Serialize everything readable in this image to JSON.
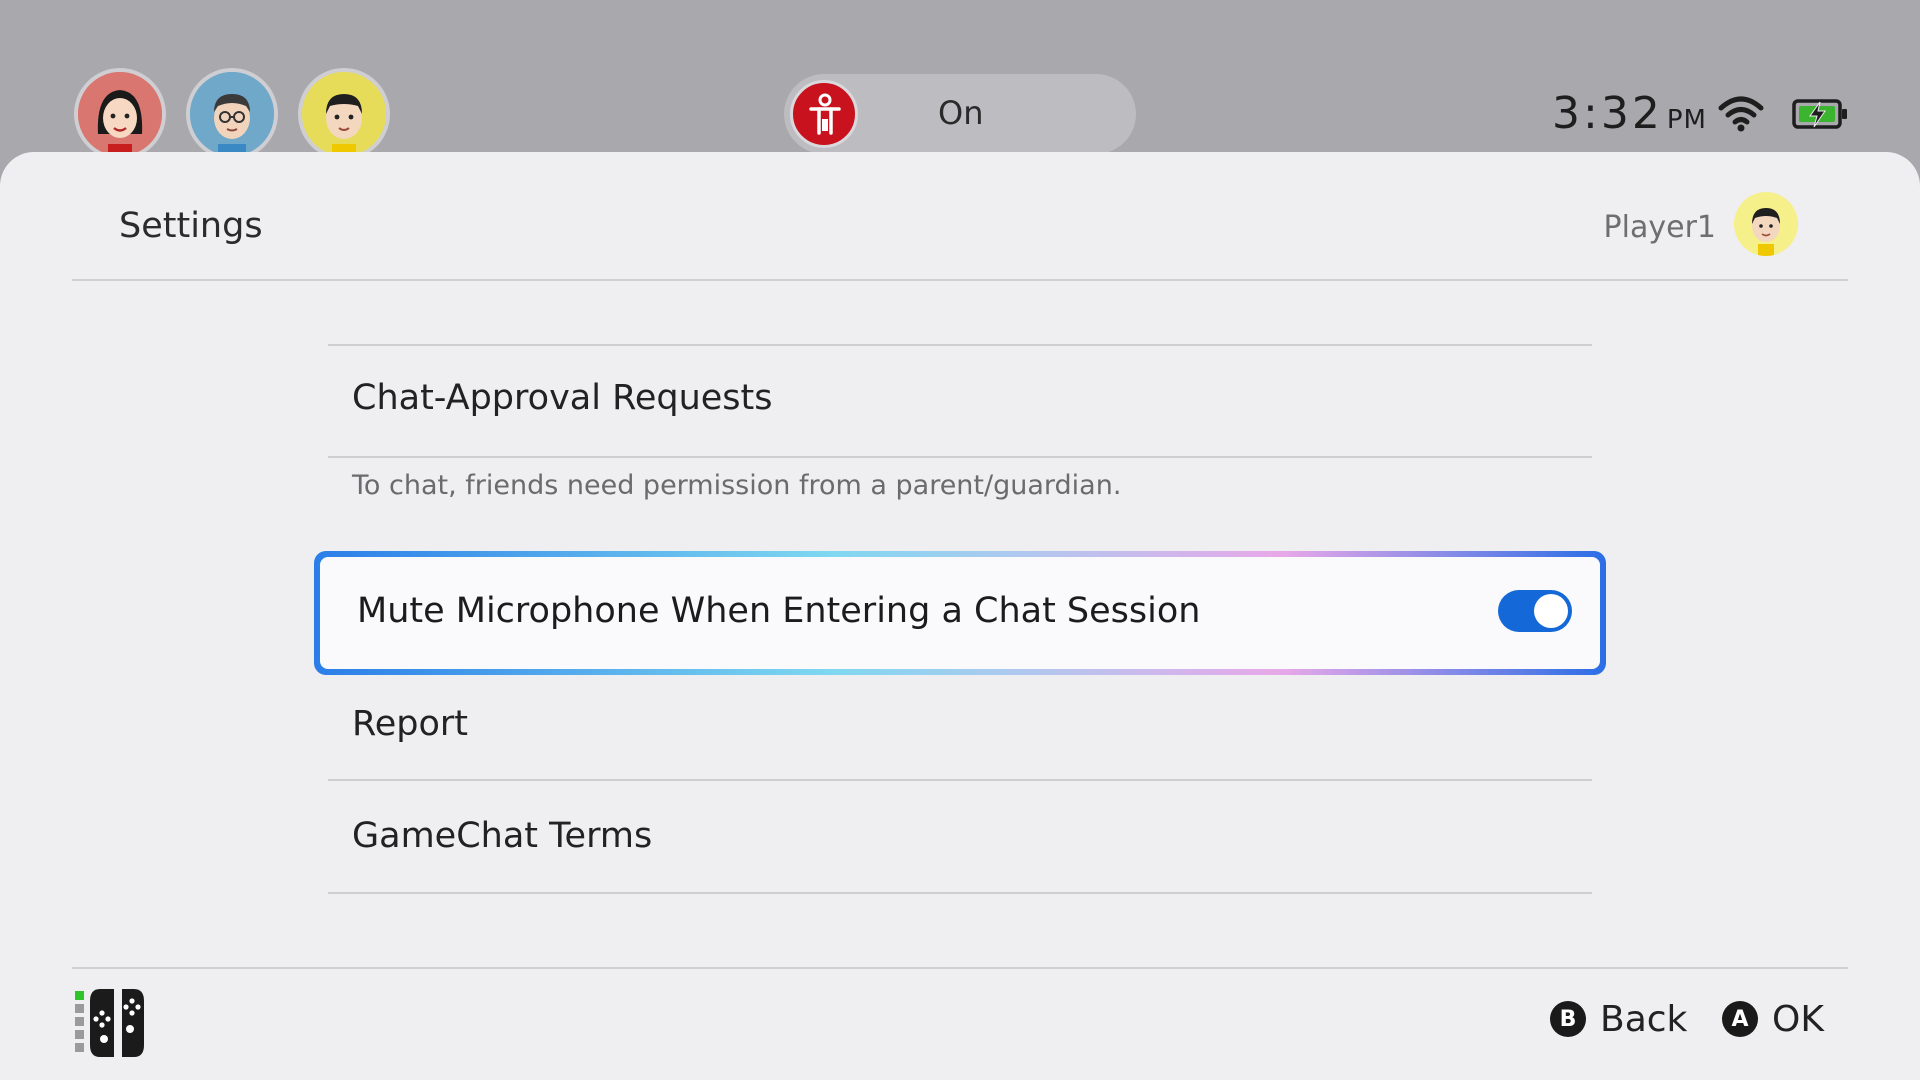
{
  "topbar": {
    "users": [
      {
        "name": "user-avatar-1",
        "color": "#d9766f"
      },
      {
        "name": "user-avatar-2",
        "color": "#6fa8c9"
      },
      {
        "name": "user-avatar-3",
        "color": "#e6dc5a"
      }
    ],
    "parental_control_icon": "parental-controls-icon",
    "parental_control_status": "On",
    "clock_time": "3:32",
    "clock_ampm": "PM",
    "wifi_icon": "wifi-icon",
    "battery_icon": "battery-charging-icon"
  },
  "panel": {
    "title": "Settings",
    "player_name": "Player1"
  },
  "list": {
    "items": [
      {
        "label": "Chat-Approval Requests"
      },
      {
        "label": "Mute Microphone When Entering a Chat Session",
        "toggle": true,
        "selected": true
      },
      {
        "label": "Report"
      },
      {
        "label": "GameChat Terms"
      }
    ],
    "chat_approval_desc": "To chat, friends need permission from a parent/guardian."
  },
  "footer": {
    "controller_icon": "joy-con-icon",
    "back_button_glyph": "B",
    "back_label": "Back",
    "ok_button_glyph": "A",
    "ok_label": "OK"
  },
  "colors": {
    "accent": "#1468d8",
    "parental_red": "#c8121d",
    "panel_bg": "#efeef1",
    "top_bg": "#a9a8ac"
  }
}
